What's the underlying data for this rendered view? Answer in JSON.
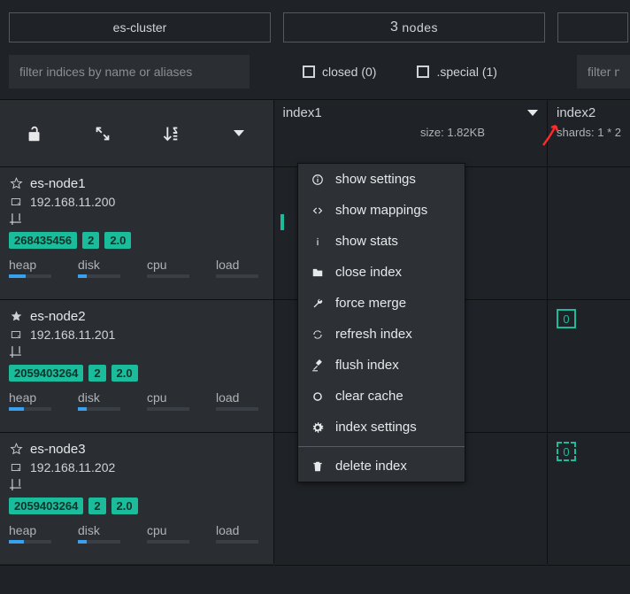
{
  "tabs": {
    "cluster": "es-cluster",
    "nodes_count": "3",
    "nodes_label": "nodes"
  },
  "filters": {
    "indices_placeholder": "filter indices by name or aliases",
    "closed_label": "closed (0)",
    "special_label": ".special (1)",
    "nodes_placeholder": "filter nodes"
  },
  "node_header_icons": [
    "unlock",
    "expand",
    "sort-az",
    "caret"
  ],
  "indices": [
    {
      "name": "index1",
      "size": "size: 1.82KB",
      "has_menu": true
    },
    {
      "name": "index2",
      "shards": "shards: 1 * 2"
    }
  ],
  "menu": {
    "items": [
      {
        "icon": "info",
        "label": "show settings"
      },
      {
        "icon": "code",
        "label": "show mappings"
      },
      {
        "icon": "i",
        "label": "show stats"
      },
      {
        "icon": "folder",
        "label": "close index"
      },
      {
        "icon": "wrench",
        "label": "force merge"
      },
      {
        "icon": "refresh",
        "label": "refresh index"
      },
      {
        "icon": "gavel",
        "label": "flush index"
      },
      {
        "icon": "circle",
        "label": "clear cache"
      },
      {
        "icon": "gear",
        "label": "index settings"
      }
    ],
    "delete": {
      "icon": "trash",
      "label": "delete index"
    }
  },
  "nodes": [
    {
      "name": "es-node1",
      "ip": "192.168.11.200",
      "chips": [
        "268435456",
        "2",
        "2.0"
      ],
      "metrics": {
        "heap": 40,
        "disk": 20,
        "cpu": 0,
        "load": 0
      }
    },
    {
      "name": "es-node2",
      "ip": "192.168.11.201",
      "chips": [
        "2059403264",
        "2",
        "2.0"
      ],
      "metrics": {
        "heap": 35,
        "disk": 20,
        "cpu": 0,
        "load": 0
      }
    },
    {
      "name": "es-node3",
      "ip": "192.168.11.202",
      "chips": [
        "2059403264",
        "2",
        "2.0"
      ],
      "metrics": {
        "heap": 35,
        "disk": 20,
        "cpu": 0,
        "load": 0
      }
    }
  ],
  "metric_labels": [
    "heap",
    "disk",
    "cpu",
    "load"
  ],
  "shards": {
    "col2_row2": "0",
    "col2_row3": "0"
  }
}
